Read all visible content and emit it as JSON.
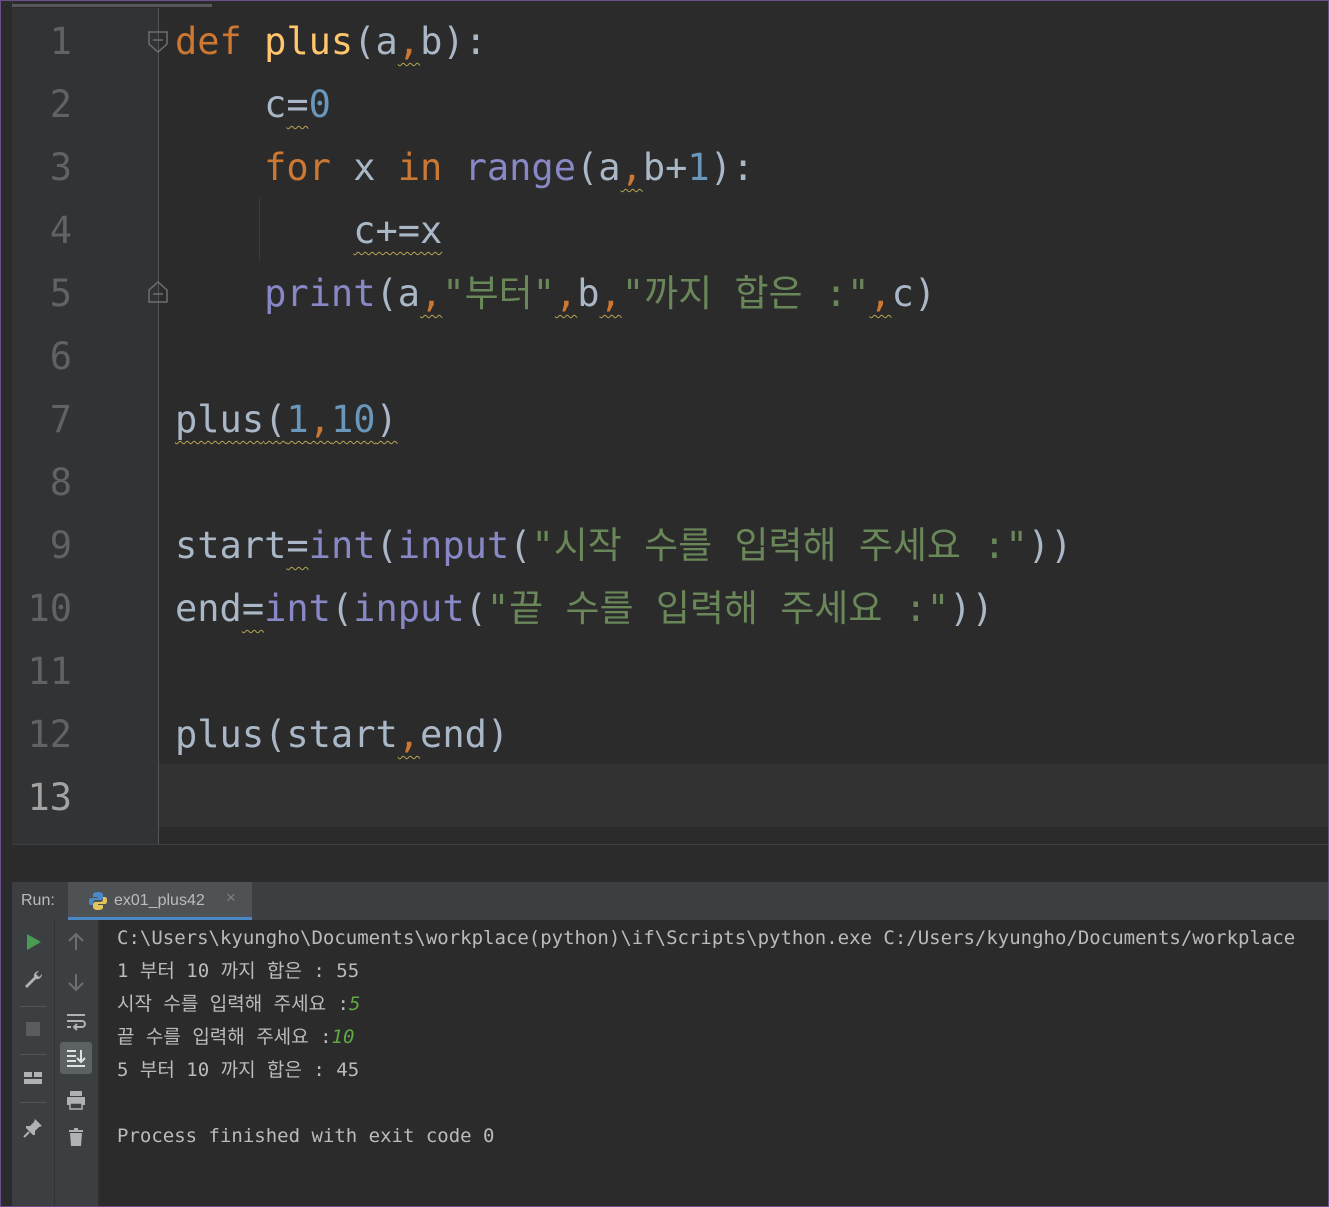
{
  "editor": {
    "line_numbers": [
      "1",
      "2",
      "3",
      "4",
      "5",
      "6",
      "7",
      "8",
      "9",
      "10",
      "11",
      "12",
      "13"
    ],
    "active_line": "13",
    "lines": {
      "l1": {
        "kw_def": "def",
        "fn_name": "plus",
        "rest": "(a",
        "comma": ",",
        "rest2": "b):"
      },
      "l2": {
        "indent": "    ",
        "text": "c",
        "eq": "=",
        "num": "0"
      },
      "l3": {
        "indent": "    ",
        "kw_for": "for",
        "x": " x ",
        "kw_in": "in",
        "sp": " ",
        "bi_range": "range",
        "p1": "(a",
        "comma": ",",
        "p2": "b+",
        "num": "1",
        "p3": "):"
      },
      "l4": {
        "indent": "        ",
        "text": "c+=x"
      },
      "l5": {
        "indent": "    ",
        "bi_print": "print",
        "p1": "(a",
        "c1": ",",
        "s1": "\"부터\"",
        "c2": ",",
        "b": "b",
        "c3": ",",
        "s2": "\"까지 합은 :\"",
        "c4": ",",
        "end": "c)"
      },
      "l7": {
        "text": "plus",
        "p1": "(",
        "n1": "1",
        "comma": ",",
        "n2": "10",
        "p2": ")"
      },
      "l9": {
        "var": "start",
        "eq": "=",
        "bi_int": "int",
        "p1": "(",
        "bi_input": "input",
        "p2": "(",
        "str": "\"시작 수를 입력해 주세요 :\"",
        "p3": "))"
      },
      "l10": {
        "var": "end",
        "eq": "=",
        "bi_int": "int",
        "p1": "(",
        "bi_input": "input",
        "p2": "(",
        "str": "\"끝 수를 입력해 주세요 :\"",
        "p3": "))"
      },
      "l12": {
        "text": "plus",
        "p1": "(start",
        "comma": ",",
        "p2": "end)"
      }
    }
  },
  "run_panel": {
    "label": "Run:",
    "tab_name": "ex01_plus42",
    "tab_close": "×",
    "console": {
      "cmd": "C:\\Users\\kyungho\\Documents\\workplace(python)\\if\\Scripts\\python.exe C:/Users/kyungho/Documents/workplace",
      "out1": "1 부터 10 까지 합은 : 55",
      "prompt1": "시작 수를 입력해 주세요 :",
      "input1": "5",
      "prompt2": "끝 수를 입력해 주세요 :",
      "input2": "10",
      "out2": "5 부터 10 까지 합은 : 45",
      "finish": "Process finished with exit code 0"
    }
  },
  "colors": {
    "background": "#2b2b2b",
    "keyword": "#cc7832",
    "function": "#ffc66d",
    "builtin": "#8888c6",
    "number": "#6897bb",
    "string": "#6a8759",
    "run_green": "#499c54",
    "tab_underline": "#4a88c7"
  },
  "icons": [
    "run-icon",
    "wrench-icon",
    "stop-icon",
    "layout-icon",
    "pin-icon",
    "up-arrow-icon",
    "down-arrow-icon",
    "soft-wrap-icon",
    "scroll-to-end-icon",
    "print-icon",
    "trash-icon",
    "python-file-icon"
  ]
}
